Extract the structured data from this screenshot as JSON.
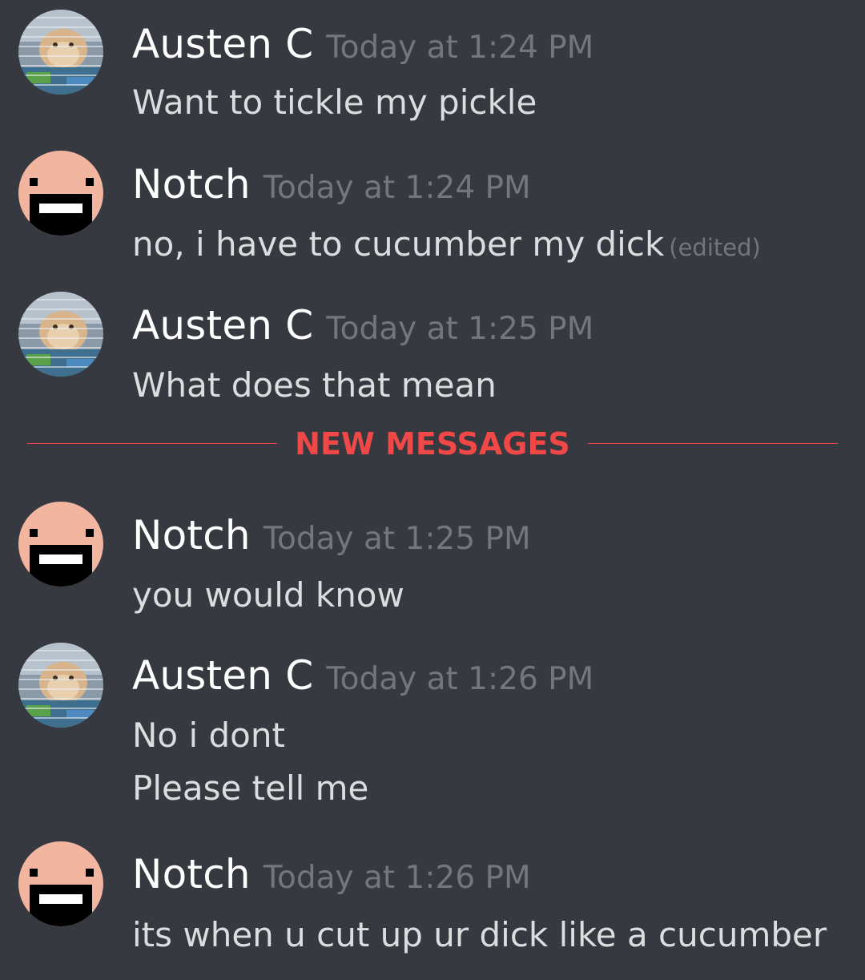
{
  "messages": [
    {
      "username": "Austen C",
      "avatar": "hamster-avatar",
      "timestamp": "Today at 1:24 PM",
      "lines": [
        "Want to tickle my pickle"
      ]
    },
    {
      "username": "Notch",
      "avatar": "smiley-face-avatar",
      "timestamp": "Today at 1:24 PM",
      "lines": [
        "no, i have to cucumber my dick"
      ],
      "edited": "(edited)"
    },
    {
      "username": "Austen C",
      "avatar": "hamster-avatar",
      "timestamp": "Today at 1:25 PM",
      "lines": [
        "What does that mean"
      ]
    },
    {
      "username": "Notch",
      "avatar": "smiley-face-avatar",
      "timestamp": "Today at 1:25 PM",
      "lines": [
        "you would know"
      ]
    },
    {
      "username": "Austen C",
      "avatar": "hamster-avatar",
      "timestamp": "Today at 1:26 PM",
      "lines": [
        "No i dont",
        "Please tell me"
      ]
    },
    {
      "username": "Notch",
      "avatar": "smiley-face-avatar",
      "timestamp": "Today at 1:26 PM",
      "lines": [
        "its when u cut up ur dick like a cucumber"
      ]
    }
  ],
  "divider": {
    "label": "NEW MESSAGES"
  },
  "colors": {
    "background": "#36393f",
    "username": "#ffffff",
    "timestamp": "#72767d",
    "message_text": "#dcddde",
    "new_messages_red": "#f04747"
  }
}
